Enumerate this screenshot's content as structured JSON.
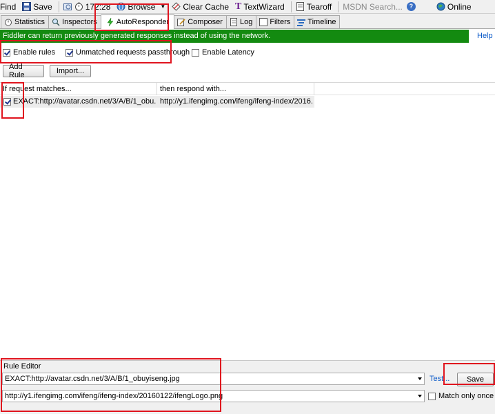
{
  "toolbar": {
    "find": "Find",
    "save": "Save",
    "process": "172:28",
    "browse": "Browse",
    "clear_cache": "Clear Cache",
    "textwizard": "TextWizard",
    "tearoff": "Tearoff",
    "search_placeholder": "MSDN Search...",
    "online": "Online"
  },
  "tabs": [
    {
      "label": "Statistics",
      "icon": "stopwatch-icon"
    },
    {
      "label": "Inspectors",
      "icon": "magnifier-icon"
    },
    {
      "label": "AutoResponder",
      "icon": "lightning-icon"
    },
    {
      "label": "Composer",
      "icon": "pencil-icon"
    },
    {
      "label": "Log",
      "icon": "document-icon"
    },
    {
      "label": "Filters",
      "icon": "checkbox-icon"
    },
    {
      "label": "Timeline",
      "icon": "timeline-icon"
    }
  ],
  "banner": {
    "text": "Fiddler can return previously generated responses instead of using the network.",
    "help": "Help",
    "color": "#138a10"
  },
  "options": {
    "enable_rules": {
      "label": "Enable rules",
      "checked": true
    },
    "unmatched": {
      "label": "Unmatched requests passthrough",
      "checked": true
    },
    "latency": {
      "label": "Enable Latency",
      "checked": false
    }
  },
  "buttons": {
    "add_rule": "Add Rule",
    "import": "Import..."
  },
  "grid": {
    "columns": [
      "If request matches...",
      "then respond with..."
    ],
    "rows": [
      {
        "checked": true,
        "match": "EXACT:http://avatar.csdn.net/3/A/B/1_obu...",
        "respond": "http://y1.ifengimg.com/ifeng/ifeng-index/2016..."
      }
    ]
  },
  "rule_editor": {
    "title": "Rule Editor",
    "match_value": "EXACT:http://avatar.csdn.net/3/A/B/1_obuyiseng.jpg",
    "respond_value": "http://y1.ifengimg.com/ifeng/ifeng-index/20160122/ifengLogo.png",
    "test_label": "Test...",
    "save_label": "Save",
    "match_once_label": "Match only once",
    "match_once_checked": false
  },
  "annotation_color": "#e0141e"
}
